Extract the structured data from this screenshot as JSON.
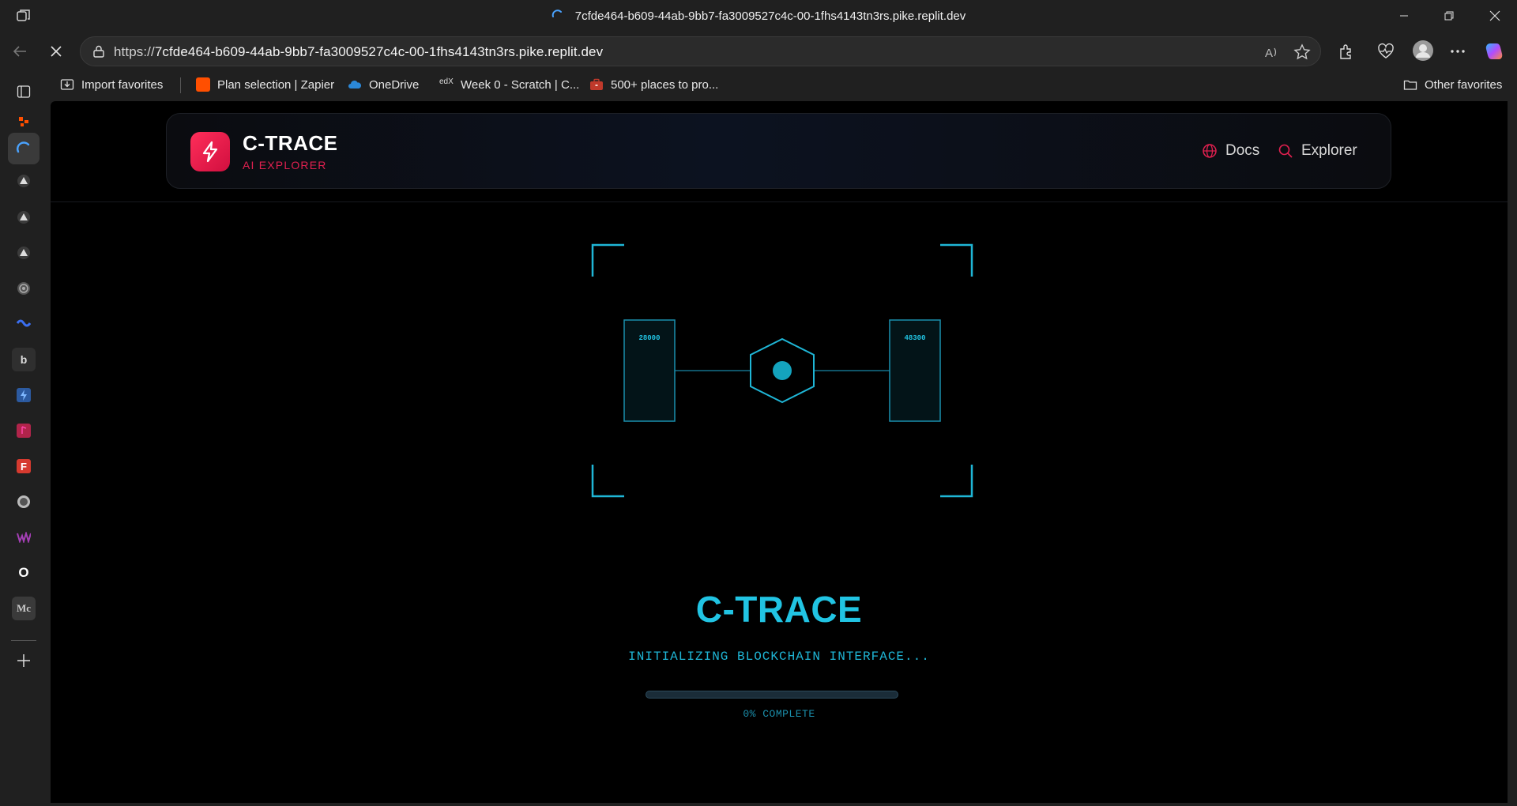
{
  "browser": {
    "tab_title": "7cfde464-b609-44ab-9bb7-fa3009527c4c-00-1fhs4143tn3rs.pike.replit.dev",
    "url_prefix": "https://",
    "url_host": "7cfde464-b609-44ab-9bb7-fa3009527c4c-00-1fhs4143tn3rs.pike.replit.dev",
    "favorites": [
      {
        "label": "Import favorites",
        "icon": "import-icon"
      },
      {
        "label": "Plan selection | Zapier",
        "icon": "zapier-icon",
        "color": "#ff4f00"
      },
      {
        "label": "OneDrive",
        "icon": "onedrive-icon",
        "color": "#2b88d8"
      },
      {
        "label": "Week 0 - Scratch | C...",
        "icon": "edx-icon"
      },
      {
        "label": "500+ places to pro...",
        "icon": "briefcase-icon",
        "color": "#c0392b"
      }
    ],
    "other_favorites": "Other favorites"
  },
  "sidebar": {
    "items": [
      "tabs-icon",
      "app-icon",
      "replit-icon",
      "app-icon",
      "app-icon",
      "app-icon",
      "app-icon",
      "app-icon",
      "bing-icon",
      "app-icon",
      "app-icon",
      "app-icon",
      "app-icon",
      "app-icon",
      "app-icon",
      "app-icon",
      "add-icon"
    ]
  },
  "app": {
    "brand": "C-TRACE",
    "brand_sub": "AI EXPLORER",
    "nav": {
      "docs": "Docs",
      "explorer": "Explorer"
    },
    "hud": {
      "left_value": "28000",
      "right_value": "48300"
    },
    "title": "C-TRACE",
    "status": "INITIALIZING BLOCKCHAIN INTERFACE...",
    "progress_percent": 0,
    "progress_text": "0% COMPLETE",
    "accent": "#21c4e3",
    "brand_color": "#e0204f"
  }
}
